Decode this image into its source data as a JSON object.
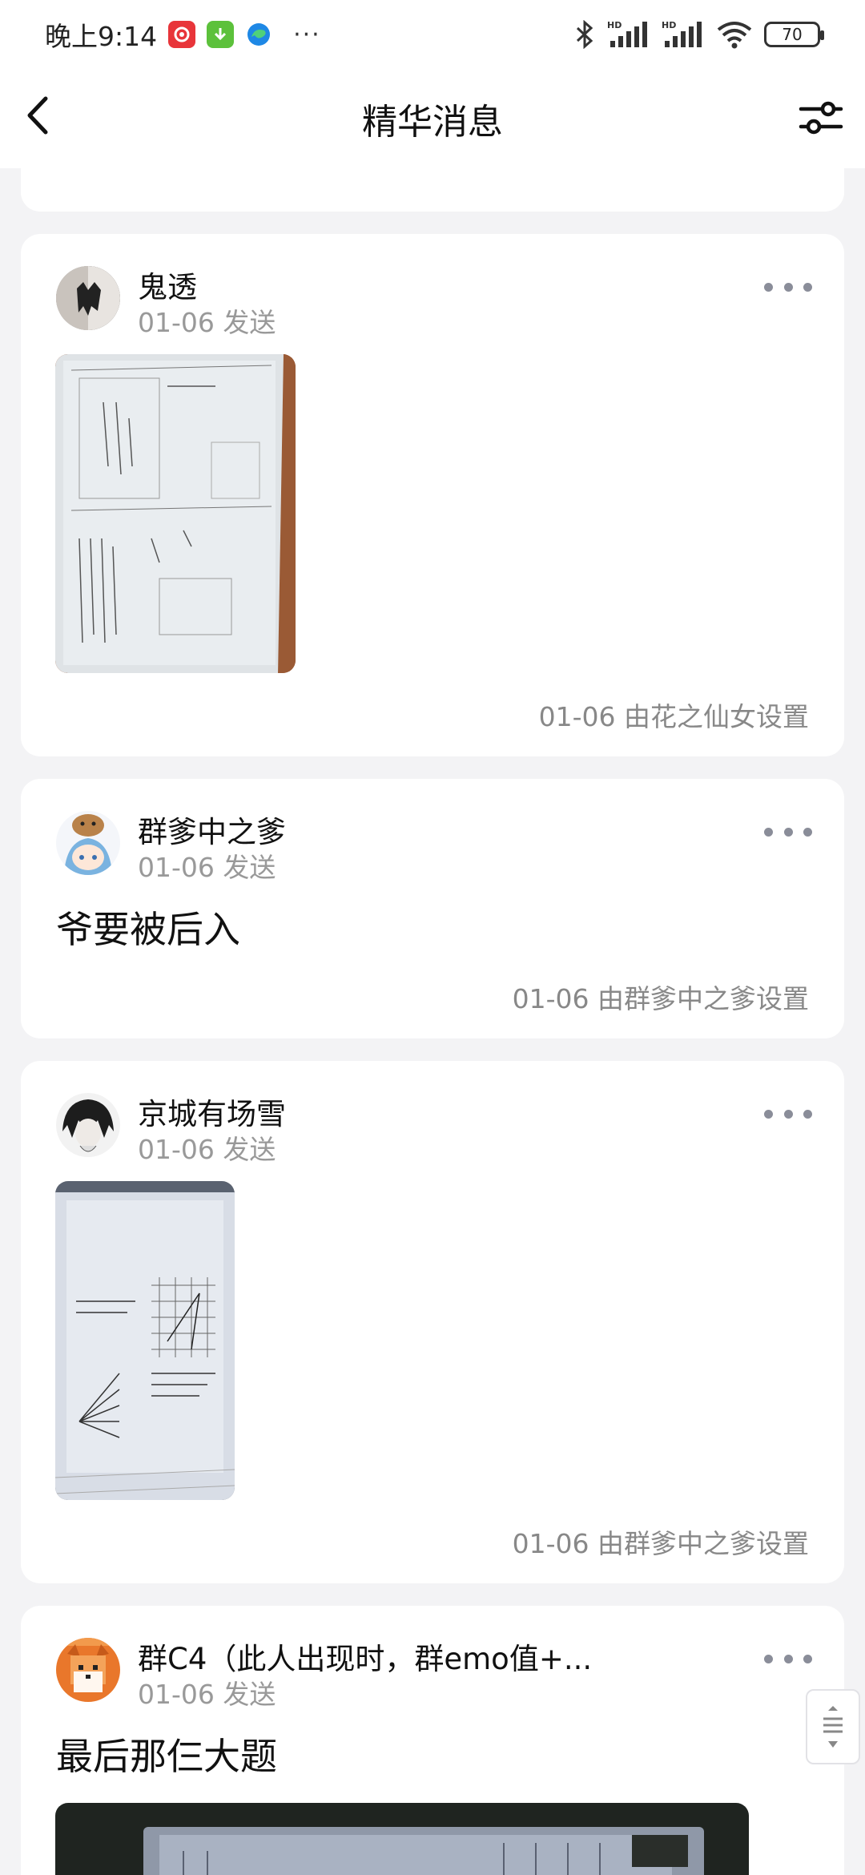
{
  "status_bar": {
    "time": "晚上9:14",
    "dots": "···",
    "battery": "70"
  },
  "header": {
    "title": "精华消息"
  },
  "posts": [
    {
      "author": "鬼透",
      "send_time": "01-06 发送",
      "has_image": true,
      "set_by": "01-06 由花之仙女设置"
    },
    {
      "author": "群爹中之爹",
      "send_time": "01-06 发送",
      "text": "爷要被后入",
      "set_by": "01-06 由群爹中之爹设置"
    },
    {
      "author": "京城有场雪",
      "send_time": "01-06 发送",
      "has_image": true,
      "set_by": "01-06 由群爹中之爹设置"
    },
    {
      "author": "群C4（此人出现时，群emo值+...",
      "send_time": "01-06 发送",
      "text": "最后那仨大题",
      "has_image": true
    }
  ],
  "colors": {
    "background": "#f3f3f5",
    "card": "#ffffff",
    "meta_text": "#999999",
    "more_dots": "#8a8d99"
  }
}
